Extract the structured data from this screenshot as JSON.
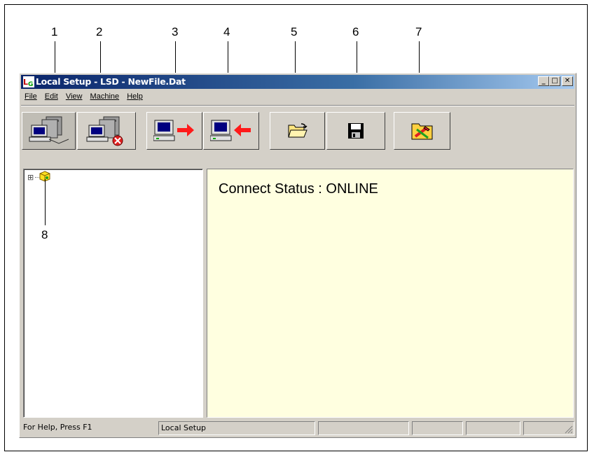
{
  "callouts": [
    "1",
    "2",
    "3",
    "4",
    "5",
    "6",
    "7",
    "8"
  ],
  "window": {
    "title": "Local Setup - LSD - NewFile.Dat",
    "app_icon": "lsd-app-icon"
  },
  "window_controls": {
    "minimize": "_",
    "maximize": "□",
    "close": "✕"
  },
  "menu": [
    {
      "label": "File",
      "mnemonic": "F"
    },
    {
      "label": "Edit",
      "mnemonic": "E"
    },
    {
      "label": "View",
      "mnemonic": "V"
    },
    {
      "label": "Machine",
      "mnemonic": "M"
    },
    {
      "label": "Help",
      "mnemonic": "H"
    }
  ],
  "toolbar": [
    {
      "name": "connect-button",
      "icon": "computer-connect-icon",
      "state": "pressed"
    },
    {
      "name": "disconnect-button",
      "icon": "computer-disconnect-icon",
      "state": "normal"
    },
    {
      "name": "send-to-machine-button",
      "icon": "computer-send-icon",
      "state": "normal"
    },
    {
      "name": "receive-from-machine-button",
      "icon": "computer-receive-icon",
      "state": "normal"
    },
    {
      "name": "open-file-button",
      "icon": "folder-open-icon",
      "state": "normal"
    },
    {
      "name": "save-file-button",
      "icon": "floppy-disk-icon",
      "state": "normal"
    },
    {
      "name": "setup-tools-button",
      "icon": "folder-tools-icon",
      "state": "normal"
    }
  ],
  "tree": {
    "expander": "⊞",
    "root_icon": "cube-icon"
  },
  "content": {
    "connect_status": "Connect Status : ONLINE"
  },
  "statusbar": {
    "help": "For Help, Press F1",
    "mode": "Local Setup"
  },
  "colors": {
    "titlebar_start": "#0a246a",
    "content_bg": "#ffffe0",
    "window_bg": "#d4d0c8"
  }
}
